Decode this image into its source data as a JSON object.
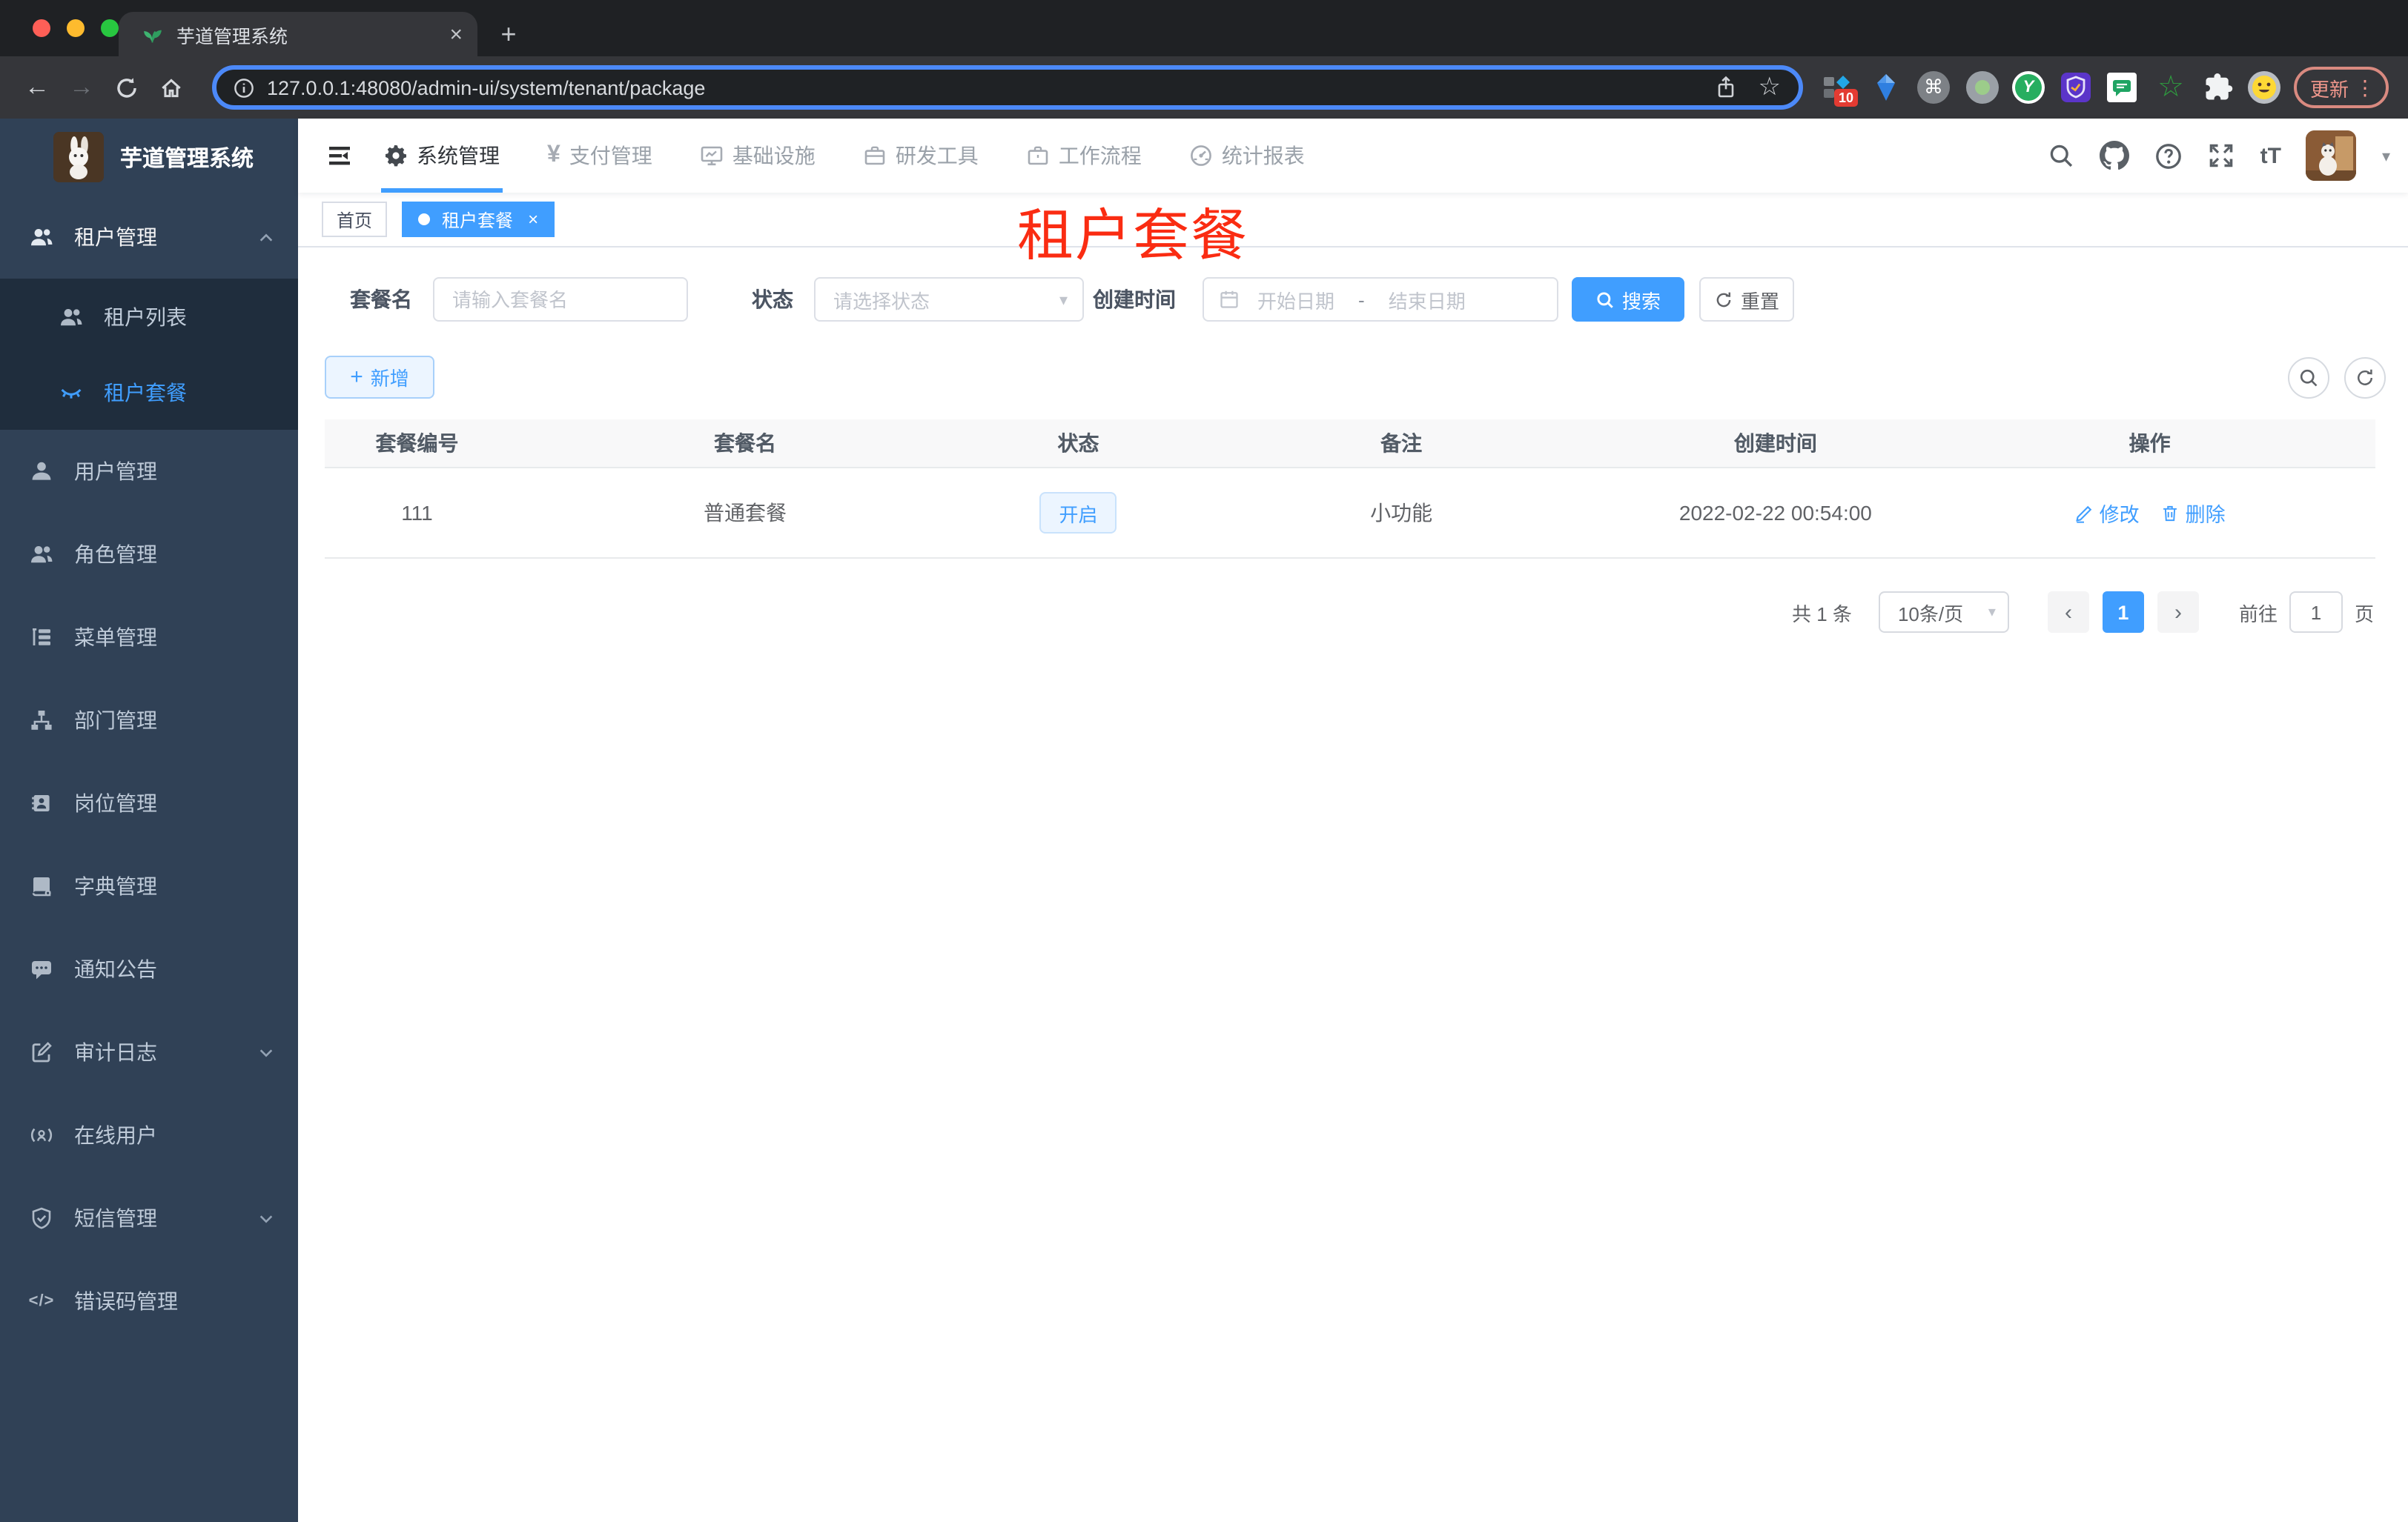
{
  "browser": {
    "tab": {
      "title": "芋道管理系统"
    },
    "url": "127.0.0.1:48080/admin-ui/system/tenant/package",
    "update_button": "更新",
    "extension_badge": "10"
  },
  "glyphs": {
    "close": "×",
    "plus": "+",
    "kebab": "⋮",
    "back": "←",
    "forward": "→",
    "star": "☆",
    "command": "⌘",
    "prev": "‹",
    "next": "›",
    "caret_down": "▾",
    "font_size": "tT",
    "yen": "¥",
    "code": "</>",
    "y_letter": "Y",
    "dash": "-"
  },
  "sidebar": {
    "app_title": "芋道管理系统",
    "items": [
      {
        "label": "租户管理",
        "icon": "users-icon"
      },
      {
        "label": "租户列表",
        "icon": "users-icon"
      },
      {
        "label": "租户套餐",
        "icon": "eye-closed-icon"
      },
      {
        "label": "用户管理",
        "icon": "user-icon"
      },
      {
        "label": "角色管理",
        "icon": "users-icon"
      },
      {
        "label": "菜单管理",
        "icon": "tree-icon"
      },
      {
        "label": "部门管理",
        "icon": "org-icon"
      },
      {
        "label": "岗位管理",
        "icon": "badge-icon"
      },
      {
        "label": "字典管理",
        "icon": "book-icon"
      },
      {
        "label": "通知公告",
        "icon": "message-icon"
      },
      {
        "label": "审计日志",
        "icon": "log-icon"
      },
      {
        "label": "在线用户",
        "icon": "broadcast-icon"
      },
      {
        "label": "短信管理",
        "icon": "shield-icon"
      },
      {
        "label": "错误码管理",
        "icon": "code-icon"
      }
    ]
  },
  "topnav": {
    "items": [
      {
        "label": "系统管理"
      },
      {
        "label": "支付管理"
      },
      {
        "label": "基础设施"
      },
      {
        "label": "研发工具"
      },
      {
        "label": "工作流程"
      },
      {
        "label": "统计报表"
      }
    ]
  },
  "tags": {
    "home": "首页",
    "active": "租户套餐"
  },
  "overlay_label": "租户套餐",
  "filters": {
    "name_label": "套餐名",
    "name_placeholder": "请输入套餐名",
    "status_label": "状态",
    "status_placeholder": "请选择状态",
    "date_label": "创建时间",
    "date_start": "开始日期",
    "date_end": "结束日期",
    "search": "搜索",
    "reset": "重置"
  },
  "toolbar": {
    "add": "新增"
  },
  "table": {
    "headers": [
      "套餐编号",
      "套餐名",
      "状态",
      "备注",
      "创建时间",
      "操作"
    ],
    "rows": [
      {
        "id": "111",
        "name": "普通套餐",
        "status": "开启",
        "remark": "小功能",
        "created": "2022-02-22 00:54:00",
        "edit": "修改",
        "delete": "删除"
      }
    ]
  },
  "pagination": {
    "total": "共 1 条",
    "page_size": "10条/页",
    "current": "1",
    "goto": "前往",
    "goto_value": "1",
    "unit": "页"
  },
  "colors": {
    "primary": "#409eff",
    "sidebar_bg": "#304156",
    "submenu_bg": "#1f2d3d",
    "annotation_red": "#fa2c12"
  }
}
